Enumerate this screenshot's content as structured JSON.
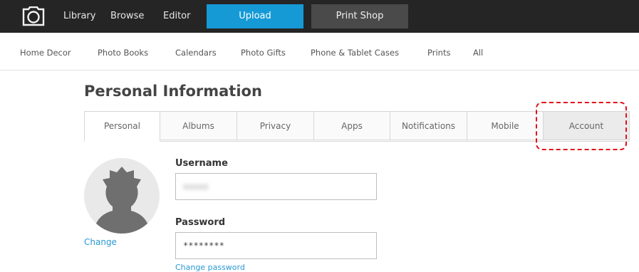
{
  "topbar": {
    "nav": [
      "Library",
      "Browse",
      "Editor"
    ],
    "upload_label": "Upload",
    "print_shop_label": "Print Shop"
  },
  "categories": [
    "Home Decor",
    "Photo Books",
    "Calendars",
    "Photo Gifts",
    "Phone & Tablet Cases",
    "Prints",
    "All"
  ],
  "page": {
    "title": "Personal Information"
  },
  "tabs": [
    "Personal",
    "Albums",
    "Privacy",
    "Apps",
    "Notifications",
    "Mobile",
    "Account"
  ],
  "active_tab": "Personal",
  "avatar": {
    "change_label": "Change"
  },
  "form": {
    "username_label": "Username",
    "username_value": "xxxxx",
    "password_label": "Password",
    "password_value": "********",
    "change_password_label": "Change password"
  },
  "colors": {
    "topbar": "#252525",
    "upload": "#159ad6",
    "print_shop": "#4a4a4a",
    "link": "#2a98d2",
    "highlight": "#e3101c"
  }
}
